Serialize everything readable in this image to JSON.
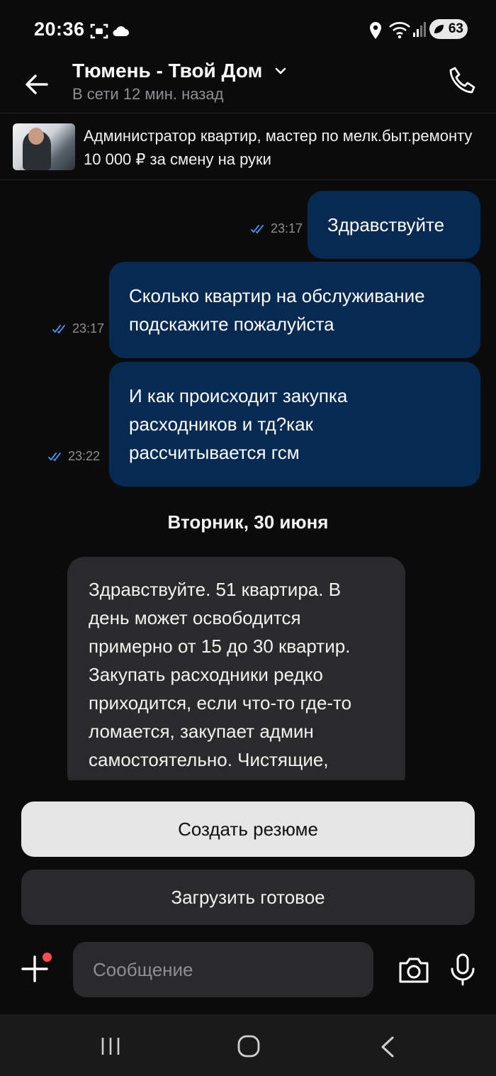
{
  "status_bar": {
    "time": "20:36",
    "battery": "63",
    "icons": [
      "screenshot-icon",
      "cloud-icon",
      "location-icon",
      "wifi-icon",
      "signal-icon",
      "battery-icon"
    ]
  },
  "header": {
    "title": "Тюмень - Твой Дом",
    "subtitle": "В сети 12 мин. назад"
  },
  "vacancy": {
    "title": "Администратор квартир, мастер по мелк.быт.ремонту",
    "salary": "10 000 ₽ за смену на руки"
  },
  "messages": [
    {
      "direction": "outgoing",
      "lines": [
        "Здравствуйте"
      ],
      "time": "23:17",
      "status": "read"
    },
    {
      "direction": "outgoing",
      "lines": [
        "Сколько  квартир на обслуживание",
        "подскажите пожалуйста"
      ],
      "time": "23:17",
      "status": "read"
    },
    {
      "direction": "outgoing",
      "lines": [
        "И как происходит закупка",
        "расходников и тд?как",
        "рассчитывается гсм"
      ],
      "time": "23:22",
      "status": "read"
    }
  ],
  "date_separator": "Вторник, 30 июня",
  "incoming": {
    "lines": [
      "Здравствуйте. 51 квартира. В",
      "день может освободится",
      "примерно от 15 до 30 квартир.",
      "Закупать расходники редко",
      "приходится, если что-то где-то",
      "ломается, закупает админ",
      "самостоятельно. Чистящие,"
    ]
  },
  "actions": {
    "create_resume": "Создать резюме",
    "upload_ready": "Загрузить готовое"
  },
  "composer": {
    "placeholder": "Сообщение"
  },
  "colors": {
    "background": "#0b0b0c",
    "outgoing_bubble": "#062a52",
    "incoming_bubble": "#2a2a2c",
    "read_ticks": "#4a9eff",
    "notification_dot": "#ff4d4f"
  }
}
